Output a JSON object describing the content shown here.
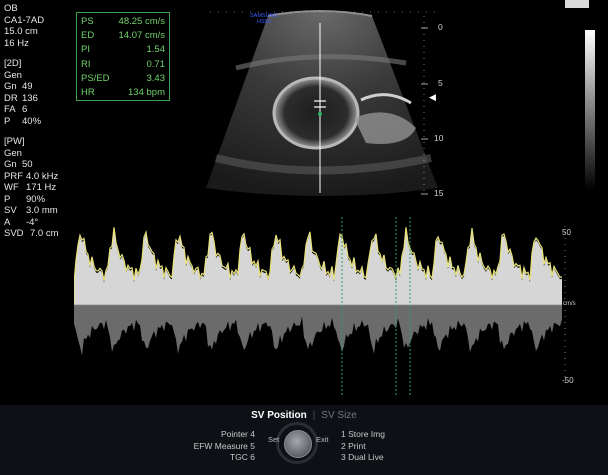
{
  "header": {
    "exam": "OB",
    "probe": "CA1-7AD",
    "depth": "15.0 cm",
    "frame_rate": "16 Hz"
  },
  "mode_2d": {
    "title": "[2D]",
    "gen": "Gen",
    "gn_label": "Gn",
    "gn_value": "49",
    "dr_label": "DR",
    "dr_value": "136",
    "fa_label": "FA",
    "fa_value": "6",
    "p_label": "P",
    "p_value": "40%"
  },
  "mode_pw": {
    "title": "[PW]",
    "gen": "Gen",
    "gn_label": "Gn",
    "gn_value": "50",
    "prf_label": "PRF",
    "prf_value": "4.0 kHz",
    "wf_label": "WF",
    "wf_value": "171 Hz",
    "p_label": "P",
    "p_value": "90%",
    "sv_label": "SV",
    "sv_value": "3.0 mm",
    "a_label": "A",
    "a_value": "-4°",
    "svd_label": "SVD",
    "svd_value": "7.0 cm"
  },
  "measurements": [
    {
      "label": "PS",
      "value": "48.25 cm/s"
    },
    {
      "label": "ED",
      "value": "14.07 cm/s"
    },
    {
      "label": "PI",
      "value": "1.54"
    },
    {
      "label": "RI",
      "value": "0.71"
    },
    {
      "label": "PS/ED",
      "value": "3.43"
    },
    {
      "label": "HR",
      "value": "134 bpm"
    }
  ],
  "brand": {
    "line1": "SAMSUNG",
    "line2": "HS50"
  },
  "depth_scale": [
    "0",
    "5",
    "10",
    "15"
  ],
  "doppler_scale": {
    "top": "50",
    "unit": "cm/s",
    "bottom": "-50"
  },
  "bottom_bar": {
    "tab_active": "SV Position",
    "tab_inactive": "SV Size",
    "left_menu": [
      {
        "label": "Pointer",
        "key": "4"
      },
      {
        "label": "EFW Measure",
        "key": "5"
      },
      {
        "label": "TGC",
        "key": "6"
      }
    ],
    "right_menu": [
      {
        "key": "1",
        "label": "Store Img"
      },
      {
        "key": "2",
        "label": "Print"
      },
      {
        "key": "3",
        "label": "Dual Live"
      }
    ],
    "knob_left": "Set",
    "knob_right": "Exit"
  },
  "colors": {
    "measure_text": "#71d36b",
    "trace_yellow": "#e8e27a",
    "baseline": "#8a8a8a"
  }
}
